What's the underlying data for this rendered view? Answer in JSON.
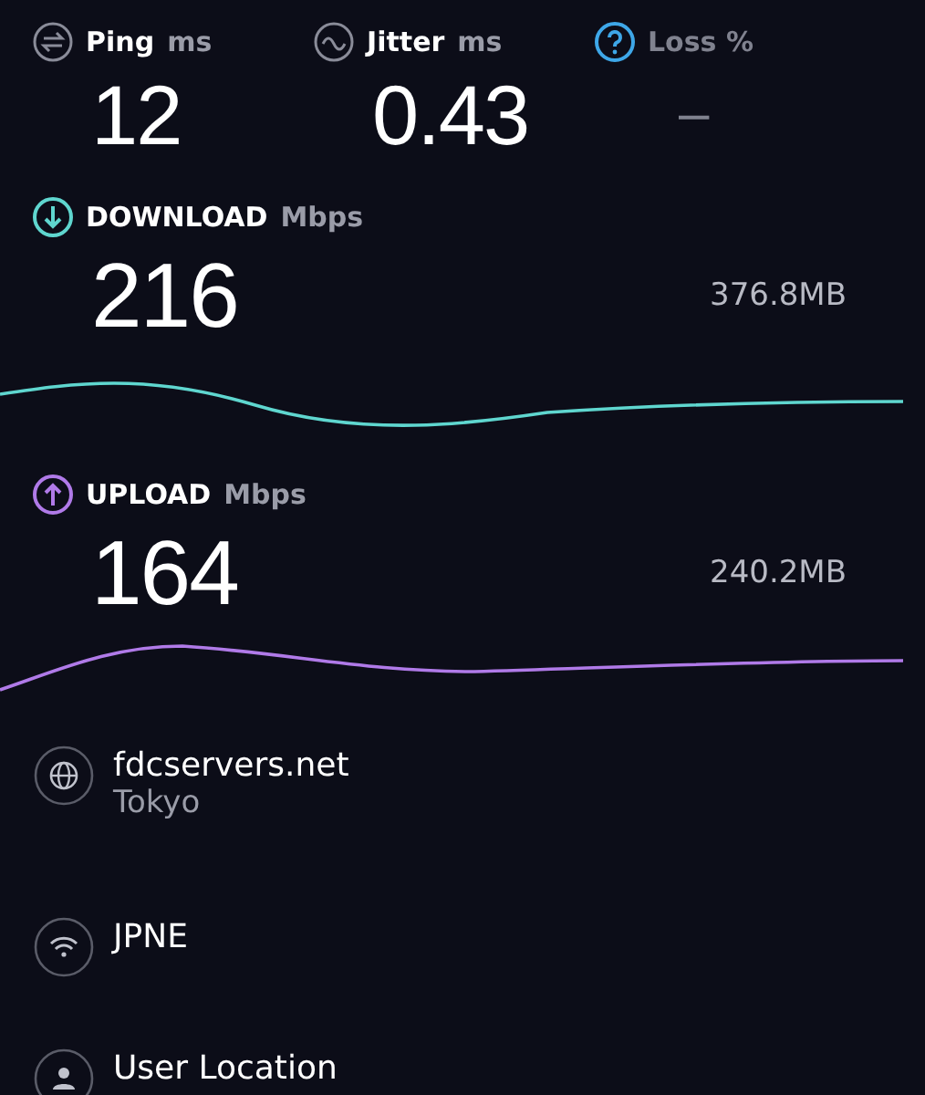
{
  "metrics": [
    {
      "kind": "ping",
      "label": "Ping",
      "unit": "ms",
      "value": "12",
      "active": true
    },
    {
      "kind": "jitter",
      "label": "Jitter",
      "unit": "ms",
      "value": "0.43",
      "active": true
    },
    {
      "kind": "loss",
      "label": "Loss %",
      "value": "–",
      "active": false
    }
  ],
  "transfers": [
    {
      "kind": "download",
      "label": "DOWNLOAD",
      "unit": "Mbps",
      "value": "216",
      "size": "376.8MB",
      "color": "#5fd6cf"
    },
    {
      "kind": "upload",
      "label": "UPLOAD",
      "unit": "Mbps",
      "value": "164",
      "size": "240.2MB",
      "color": "#b07ae8"
    }
  ],
  "info": [
    {
      "kind": "globe",
      "title": "fdcservers.net",
      "subtitle": "Tokyo"
    },
    {
      "kind": "wifi",
      "title": "JPNE"
    },
    {
      "kind": "person",
      "title": "User Location"
    }
  ]
}
